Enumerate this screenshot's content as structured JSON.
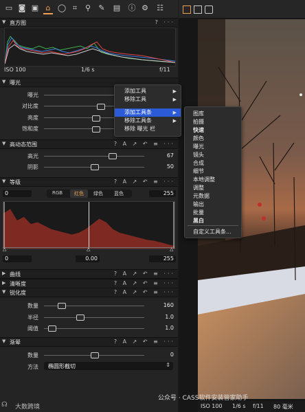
{
  "toolbar": {
    "icons": [
      "folder-icon",
      "camera-icon",
      "photo-icon",
      "exposure-tab-icon",
      "lens-icon",
      "crop-icon",
      "search-icon",
      "brush-icon",
      "metadata-icon",
      "info-icon",
      "settings-icon",
      "sliders-icon"
    ]
  },
  "histogram": {
    "title": "直方图",
    "iso": "ISO 100",
    "shutter": "1/6 s",
    "aperture": "f/11",
    "help": "?",
    "more": "···"
  },
  "exposure": {
    "title": "曝光",
    "tools": "? A ↗ ↶ ≡ ···",
    "rows": [
      {
        "label": "曝光"
      },
      {
        "label": "对比度"
      },
      {
        "label": "亮度"
      },
      {
        "label": "饱和度"
      }
    ]
  },
  "hdr": {
    "title": "高动态范围",
    "tools": "? A ↗ ↶ ≡ ···",
    "rows": [
      {
        "label": "高光",
        "value": "67"
      },
      {
        "label": "阴影",
        "value": "50"
      }
    ]
  },
  "levels": {
    "title": "等级",
    "tools": "? A ↗ ↶ ≡ ···",
    "left_value": "0",
    "right_value": "255",
    "channels": [
      "RGB",
      "红色",
      "绿色",
      "蓝色"
    ],
    "active_channel": "红色",
    "bottom_left": "0",
    "bottom_mid": "0.00",
    "bottom_right": "255",
    "chart_data": {
      "type": "area",
      "x": [
        0,
        4,
        8,
        12,
        16,
        20,
        24,
        28,
        32,
        36,
        40,
        44,
        48,
        52,
        56,
        60,
        64,
        68,
        72,
        76,
        80,
        84,
        88,
        92,
        96,
        100
      ],
      "values": [
        40,
        45,
        32,
        36,
        28,
        30,
        26,
        22,
        20,
        18,
        16,
        18,
        22,
        28,
        34,
        30,
        22,
        18,
        16,
        14,
        12,
        10,
        9,
        7,
        5,
        3
      ]
    }
  },
  "curves": {
    "title": "曲线",
    "tools": "? A ↗ ↶ ≡ ···"
  },
  "clarity": {
    "title": "清晰度",
    "tools": "? A ↗ ↶ ≡ ···"
  },
  "sharpening": {
    "title": "锐化度",
    "tools": "? A ↗ ↶ ≡ ···",
    "rows": [
      {
        "label": "数量",
        "value": "160"
      },
      {
        "label": "半径",
        "value": "1.0"
      },
      {
        "label": "阈值",
        "value": "1.0"
      }
    ]
  },
  "vignette": {
    "title": "渐晕",
    "tools": "? A ↗ ↶ ≡ ···",
    "amount_label": "数量",
    "amount_value": "0",
    "method_label": "方法",
    "method_value": "椭圆形截切"
  },
  "context_menu": {
    "items": [
      "添加工具",
      "移除工具",
      "添加工具条",
      "移除工具条",
      "移除 曝光 栏"
    ],
    "highlighted": "添加工具条"
  },
  "submenu": {
    "items": [
      "图库",
      "拍摄",
      "快速",
      "颜色",
      "曝光",
      "镜头",
      "合成",
      "细节",
      "本地调整",
      "调整",
      "元数据",
      "输出",
      "批量",
      "黑白"
    ],
    "bold_items": [
      "快速",
      "黑白"
    ],
    "custom": "自定义工具条..."
  },
  "viewer_status": {
    "iso": "ISO 100",
    "shutter": "1/6 s",
    "aperture": "f/11",
    "focal": "80 毫米"
  },
  "watermark": {
    "left": "大数跨境",
    "right": "公众号 · CASS软件安装管家助手"
  },
  "colors": {
    "accent": "#f0a050",
    "highlight": "#2b5bd7",
    "histogram_fill": "#8a2b24"
  }
}
